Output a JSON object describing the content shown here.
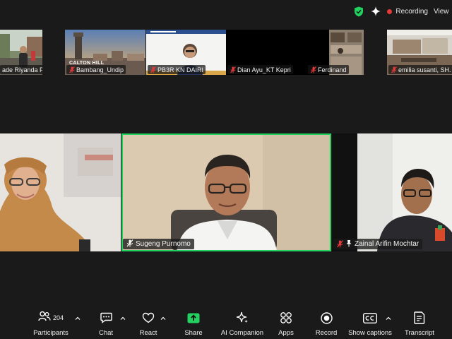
{
  "topbar": {
    "recording_label": "Recording",
    "view_label": "View"
  },
  "thumbnails": [
    {
      "name": "ade Riyanda Prasetia ..."
    },
    {
      "name": "Bambang_Undip",
      "overlay_text": "CALTON HILL"
    },
    {
      "name": "PB3R KN DAIRI"
    },
    {
      "name": "Dian Ayu_KT Kepri"
    },
    {
      "name": "Ferdinand"
    },
    {
      "name": "emilia susanti, SH. ..."
    }
  ],
  "tiles": [
    {
      "name": ""
    },
    {
      "name": "Sugeng Purnomo"
    },
    {
      "name": "Zainal Arifin Mochtar"
    }
  ],
  "toolbar": {
    "participants_label": "Participants",
    "participants_count": "204",
    "chat_label": "Chat",
    "react_label": "React",
    "share_label": "Share",
    "ai_label": "AI Companion",
    "apps_label": "Apps",
    "record_label": "Record",
    "captions_label": "Show captions",
    "transcript_label": "Transcript"
  },
  "colors": {
    "active_speaker_border": "#23d160",
    "share_green": "#23d160",
    "recording_dot": "#e5393a",
    "mic_muted": "#e5393a"
  }
}
